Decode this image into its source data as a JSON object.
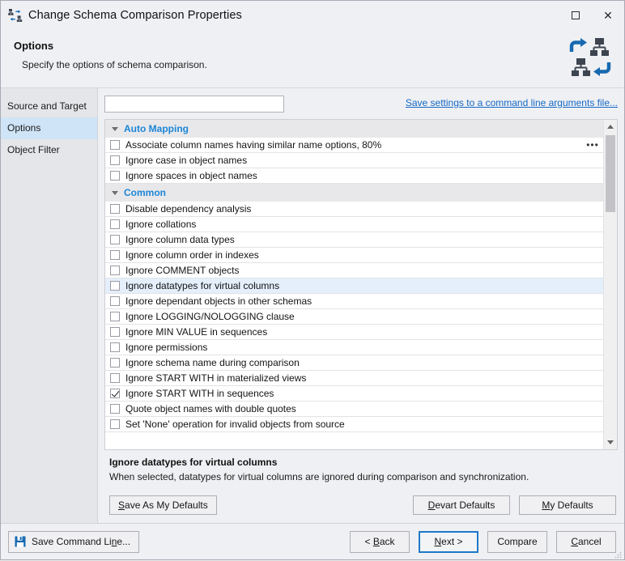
{
  "window": {
    "title": "Change Schema Comparison Properties",
    "icon": "schema-compare-icon",
    "controls": {
      "maximize": "Maximize",
      "close": "Close"
    }
  },
  "header": {
    "title": "Options",
    "subtitle": "Specify the options of schema comparison.",
    "logo_icon": "schema-sync-icon"
  },
  "sidebar": {
    "items": [
      {
        "label": "Source and Target",
        "selected": false
      },
      {
        "label": "Options",
        "selected": true
      },
      {
        "label": "Object Filter",
        "selected": false
      }
    ]
  },
  "filter": {
    "value": "",
    "placeholder": "",
    "command_line_link": "Save settings to a command line arguments file..."
  },
  "options_list": {
    "groups": [
      {
        "label": "Auto Mapping",
        "expanded": true,
        "items": [
          {
            "label": "Associate column names having similar name options, 80%",
            "checked": false,
            "selected": false,
            "has_ellipsis": true
          },
          {
            "label": "Ignore case in object names",
            "checked": false,
            "selected": false,
            "has_ellipsis": false
          },
          {
            "label": "Ignore spaces in object names",
            "checked": false,
            "selected": false,
            "has_ellipsis": false
          }
        ]
      },
      {
        "label": "Common",
        "expanded": true,
        "items": [
          {
            "label": "Disable dependency analysis",
            "checked": false,
            "selected": false,
            "has_ellipsis": false
          },
          {
            "label": "Ignore collations",
            "checked": false,
            "selected": false,
            "has_ellipsis": false
          },
          {
            "label": "Ignore column data types",
            "checked": false,
            "selected": false,
            "has_ellipsis": false
          },
          {
            "label": "Ignore column order in indexes",
            "checked": false,
            "selected": false,
            "has_ellipsis": false
          },
          {
            "label": "Ignore COMMENT objects",
            "checked": false,
            "selected": false,
            "has_ellipsis": false
          },
          {
            "label": "Ignore datatypes for virtual columns",
            "checked": false,
            "selected": true,
            "has_ellipsis": false
          },
          {
            "label": "Ignore dependant objects in other schemas",
            "checked": false,
            "selected": false,
            "has_ellipsis": false
          },
          {
            "label": "Ignore LOGGING/NOLOGGING clause",
            "checked": false,
            "selected": false,
            "has_ellipsis": false
          },
          {
            "label": "Ignore MIN VALUE in sequences",
            "checked": false,
            "selected": false,
            "has_ellipsis": false
          },
          {
            "label": "Ignore permissions",
            "checked": false,
            "selected": false,
            "has_ellipsis": false
          },
          {
            "label": "Ignore schema name during comparison",
            "checked": false,
            "selected": false,
            "has_ellipsis": false
          },
          {
            "label": "Ignore START WITH in materialized views",
            "checked": false,
            "selected": false,
            "has_ellipsis": false
          },
          {
            "label": "Ignore START WITH in sequences",
            "checked": true,
            "selected": false,
            "has_ellipsis": false
          },
          {
            "label": "Quote object names with double quotes",
            "checked": false,
            "selected": false,
            "has_ellipsis": false
          },
          {
            "label": "Set 'None' operation for invalid objects from source",
            "checked": false,
            "selected": false,
            "has_ellipsis": false
          }
        ]
      }
    ],
    "ellipsis_label": "•••"
  },
  "description": {
    "title": "Ignore datatypes for virtual columns",
    "text": "When selected, datatypes for virtual columns are ignored during comparison and synchronization."
  },
  "defaults_buttons": {
    "save_as_my_defaults": {
      "pre": "S",
      "post": "ave As My Defaults"
    },
    "devart_defaults": {
      "pre": "D",
      "post": "evart Defaults"
    },
    "my_defaults": {
      "pre": "M",
      "post": "y Defaults"
    }
  },
  "footer": {
    "save_command_line": {
      "pre": "Save Command Li",
      "mn": "n",
      "post": "e..."
    },
    "back": {
      "pre": "< ",
      "mn": "B",
      "post": "ack"
    },
    "next": {
      "pre": "",
      "mn": "N",
      "post": "ext >"
    },
    "compare": "Compare",
    "cancel": {
      "pre": "",
      "mn": "C",
      "post": "ancel"
    }
  },
  "colors": {
    "accent_link": "#1569c7",
    "group_header": "#1c86d6",
    "selection": "#cfe4f7",
    "row_selection": "#e4effb",
    "default_button_border": "#1e78c8"
  }
}
